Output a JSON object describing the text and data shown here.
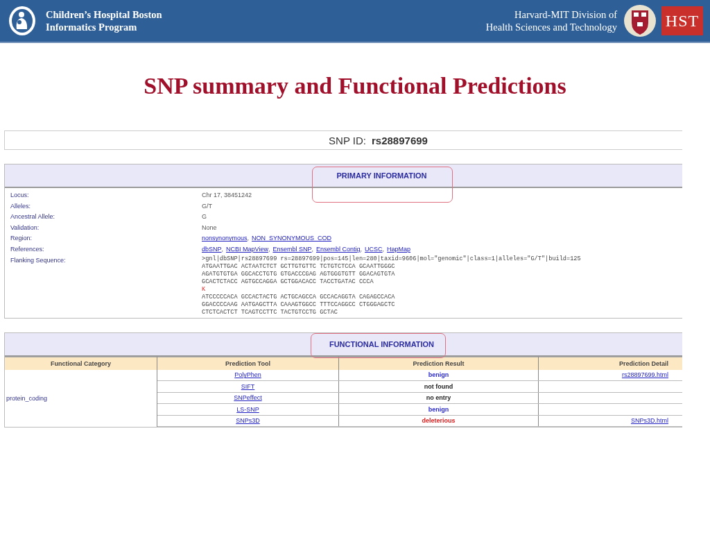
{
  "header": {
    "left_lines": [
      "Children’s Hospital Boston",
      "Informatics Program"
    ],
    "right_lines": [
      "Harvard-MIT Division of",
      "Health Sciences and Technology"
    ],
    "logo_text": "HST"
  },
  "slide_title": "SNP summary and Functional Predictions",
  "snp": {
    "label": "SNP ID:",
    "value": "rs28897699"
  },
  "primary": {
    "heading": "PRIMARY INFORMATION",
    "rows": [
      {
        "label": "Locus:",
        "kind": "text",
        "value": "Chr 17, 38451242"
      },
      {
        "label": "Alleles:",
        "kind": "text",
        "value": "G/T"
      },
      {
        "label": "Ancestral Allele:",
        "kind": "text",
        "value": "G"
      },
      {
        "label": "Validation:",
        "kind": "text",
        "value": "None"
      },
      {
        "label": "Region:",
        "kind": "links",
        "separator": ",",
        "links": [
          "nonsynonymous",
          "NON_SYNONYMOUS_COD"
        ]
      },
      {
        "label": "References:",
        "kind": "links",
        "separator": ",",
        "links": [
          "dbSNP",
          "NCBI MapView",
          "Ensembl SNP",
          "Ensembl Contig",
          "UCSC",
          "HapMap"
        ]
      },
      {
        "label": "Flanking Sequence:",
        "kind": "sequence",
        "lines": [
          {
            "text": ">gnl|dbSNP|rs28897699 rs=28897699|pos=145|len=280|taxid=9606|mol=\"genomic\"|class=1|alleles=\"G/T\"|build=125",
            "variant": false
          },
          {
            "text": "ATGAATTGAC ACTAATCTCT GCTTGTGTTC TCTGTCTCCA GCAATTGGGC",
            "variant": false
          },
          {
            "text": "AGATGTGTGA GGCACCTGTG GTGACCCGAG AGTGGGTGTT GGACAGTGTA",
            "variant": false
          },
          {
            "text": "GCACTCTACC AGTGCCAGGA GCTGGACACC TACCTGATAC CCCA",
            "variant": false
          },
          {
            "text": "K",
            "variant": true
          },
          {
            "text": "ATCCCCCACA GCCACTACTG ACTGCAGCCA GCCACAGGTA CAGAGCCACA",
            "variant": false
          },
          {
            "text": "GGACCCCAAG AATGAGCTTA CAAAGTGGCC TTTCCAGGCC CTGGGAGCTC",
            "variant": false
          },
          {
            "text": "CTCTCACTCT TCAGTCCTTC TACTGTCCTG GCTAC",
            "variant": false
          }
        ]
      }
    ]
  },
  "functional": {
    "heading": "FUNCTIONAL INFORMATION",
    "columns": [
      "Functional Category",
      "Prediction Tool",
      "Prediction Result",
      "Prediction Detail"
    ],
    "category": "protein_coding",
    "rows": [
      {
        "tool": "PolyPhen",
        "result": "benign",
        "kind": "benign",
        "detail": "rs28897699.html"
      },
      {
        "tool": "SIFT",
        "result": "not found",
        "kind": "none"
      },
      {
        "tool": "SNPeffect",
        "result": "no entry",
        "kind": "none"
      },
      {
        "tool": "LS-SNP",
        "result": "benign",
        "kind": "benign"
      },
      {
        "tool": "SNPs3D",
        "result": "deleterious",
        "kind": "damaging",
        "detail": "SNPs3D.html"
      }
    ]
  }
}
